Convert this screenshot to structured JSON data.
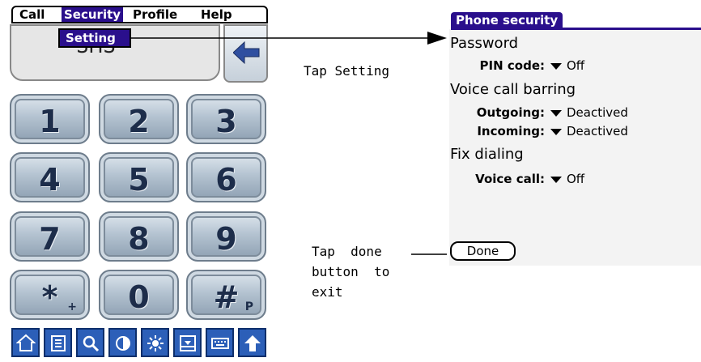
{
  "phone": {
    "menu": [
      "Call",
      "Security",
      "Profile",
      "Help"
    ],
    "dropdown_item": "Setting",
    "display_text": "SMS",
    "keys": [
      {
        "main": "1",
        "sub": ""
      },
      {
        "main": "2",
        "sub": ""
      },
      {
        "main": "3",
        "sub": ""
      },
      {
        "main": "4",
        "sub": ""
      },
      {
        "main": "5",
        "sub": ""
      },
      {
        "main": "6",
        "sub": ""
      },
      {
        "main": "7",
        "sub": ""
      },
      {
        "main": "8",
        "sub": ""
      },
      {
        "main": "9",
        "sub": ""
      },
      {
        "main": "*",
        "sub": "+"
      },
      {
        "main": "0",
        "sub": ""
      },
      {
        "main": "#",
        "sub": "P"
      }
    ],
    "toolbar_icons": [
      "home-icon",
      "list-icon",
      "search-icon",
      "contrast-icon",
      "brightness-icon",
      "inbox-icon",
      "keyboard-icon",
      "up-arrow-icon"
    ]
  },
  "annotations": {
    "tap_setting": "Tap Setting",
    "tap_done": "Tap  done\nbutton  to\nexit"
  },
  "security": {
    "tab_title": "Phone security",
    "password_heading": "Password",
    "pin_label": "PIN code:",
    "pin_value": "Off",
    "barring_heading": "Voice call barring",
    "outgoing_label": "Outgoing:",
    "outgoing_value": "Deactived",
    "incoming_label": "Incoming:",
    "incoming_value": "Deactived",
    "fix_heading": "Fix dialing",
    "voice_label": "Voice call:",
    "voice_value": "Off",
    "done_label": "Done"
  },
  "colors": {
    "accent": "#2a0f8c",
    "toolbar": "#2c5fb8"
  }
}
